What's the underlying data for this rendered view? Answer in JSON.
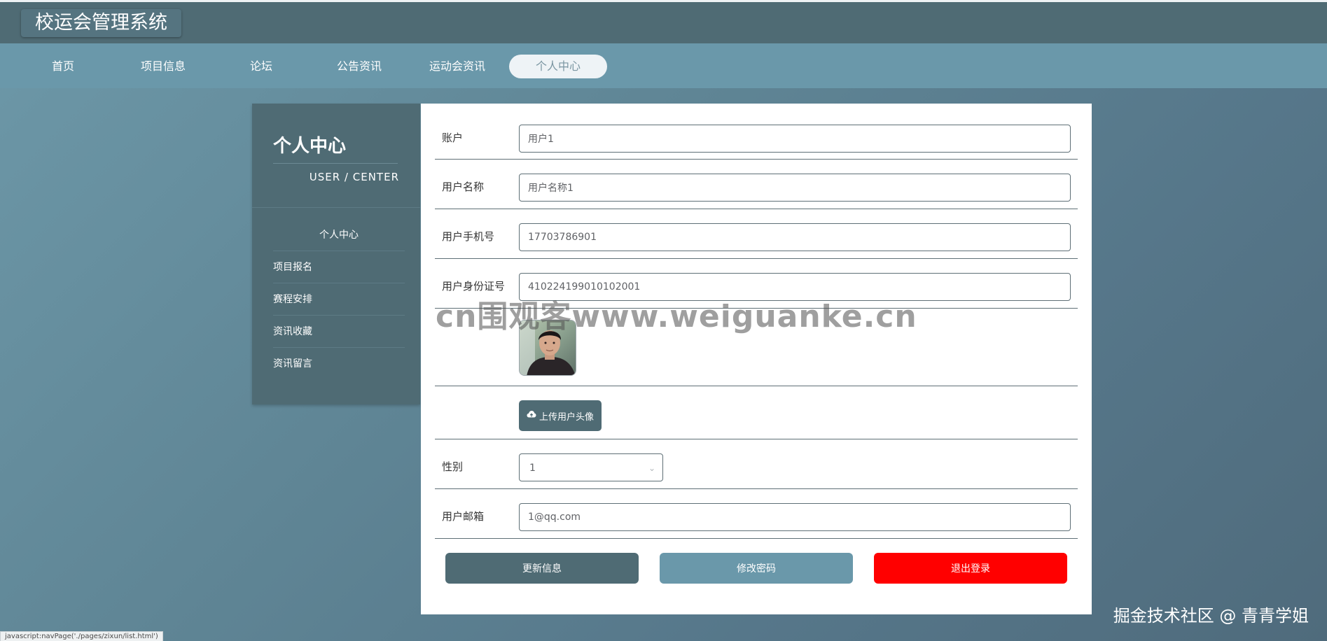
{
  "app": {
    "title": "校运会管理系统"
  },
  "nav": {
    "items": [
      {
        "label": "首页"
      },
      {
        "label": "项目信息"
      },
      {
        "label": "论坛"
      },
      {
        "label": "公告资讯"
      },
      {
        "label": "运动会资讯"
      },
      {
        "label": "个人中心",
        "active": true
      }
    ]
  },
  "sidebar": {
    "title": "个人中心",
    "subtitle": "USER / CENTER",
    "items": [
      {
        "label": "个人中心"
      },
      {
        "label": "项目报名"
      },
      {
        "label": "赛程安排"
      },
      {
        "label": "资讯收藏"
      },
      {
        "label": "资讯留言"
      }
    ]
  },
  "form": {
    "account": {
      "label": "账户",
      "value": "用户1"
    },
    "username": {
      "label": "用户名称",
      "value": "用户名称1"
    },
    "phone": {
      "label": "用户手机号",
      "value": "17703786901"
    },
    "idcard": {
      "label": "用户身份证号",
      "value": "410224199010102001"
    },
    "upload_label": "上传用户头像",
    "gender": {
      "label": "性别",
      "value": "1"
    },
    "email": {
      "label": "用户邮箱",
      "value": "1@qq.com"
    }
  },
  "actions": {
    "update_label": "更新信息",
    "password_label": "修改密码",
    "logout_label": "退出登录"
  },
  "colors": {
    "primary": "#4f6b74",
    "secondary": "#6a98aa",
    "danger": "#ff0000"
  },
  "watermark": {
    "center": "cn围观客www.weiguanke.cn",
    "corner": "掘金技术社区 @ 青青学姐"
  },
  "status_bar": {
    "text": "javascript:navPage('./pages/zixun/list.html')"
  }
}
